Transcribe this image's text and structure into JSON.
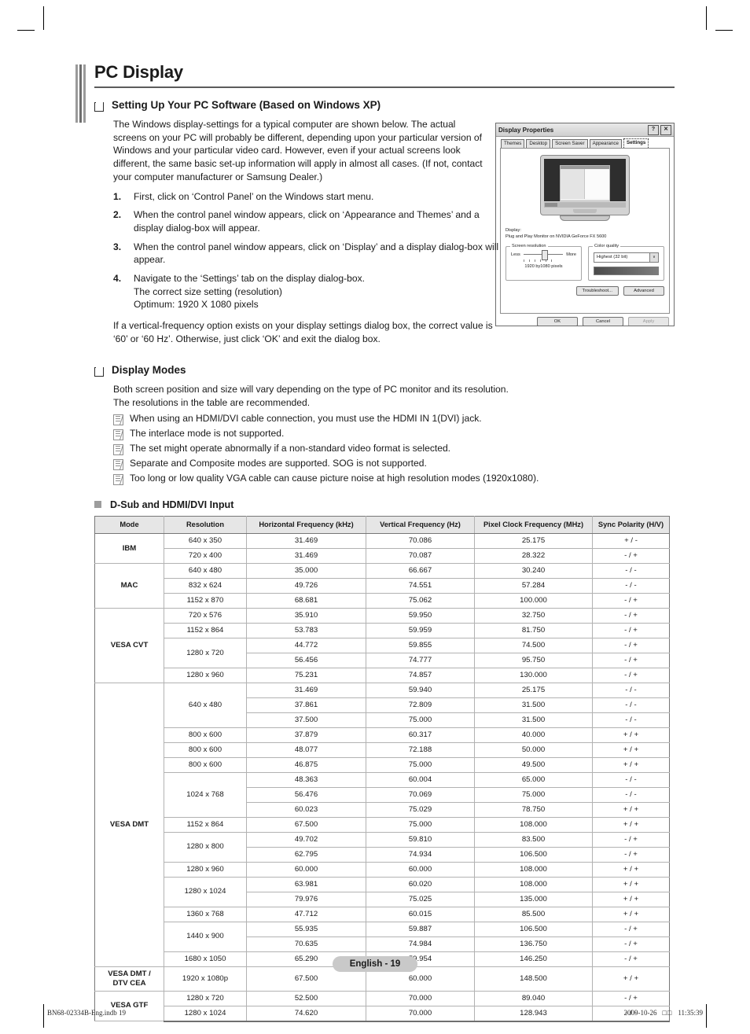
{
  "page": {
    "title": "PC Display",
    "page_label": "English - 19",
    "print_file": "BN68-02334B-Eng.indb   19",
    "print_date": "2009-10-26",
    "print_locale_glyphs": "□□",
    "print_time": "11:35:39"
  },
  "section1": {
    "heading": "Setting Up Your PC Software (Based on Windows XP)",
    "intro": "The Windows display-settings for a typical computer are shown below. The actual screens on your PC will probably be different, depending upon your particular version of Windows and your particular video card. However, even if your actual screens look different, the same basic set-up information will apply in almost all cases. (If not, contact your computer manufacturer or Samsung Dealer.)",
    "steps": [
      {
        "num": "1.",
        "text": "First, click on ‘Control Panel’ on the Windows start menu."
      },
      {
        "num": "2.",
        "text": "When the control panel window appears, click on ‘Appearance and Themes’ and a display dialog-box will appear."
      },
      {
        "num": "3.",
        "text": "When the control panel window appears, click on ‘Display’ and a display dialog-box will appear."
      },
      {
        "num": "4.",
        "text": "Navigate to the ‘Settings’ tab on the display dialog-box.\nThe correct size setting (resolution)\nOptimum: 1920 X 1080 pixels"
      }
    ],
    "closing": "If a vertical-frequency option exists on your display settings dialog box, the correct value is ‘60’ or ‘60 Hz’. Otherwise, just click ‘OK’ and exit the dialog box."
  },
  "display_properties": {
    "window_title": "Display Properties",
    "help_button": "?",
    "close_button": "✕",
    "tabs": [
      "Themes",
      "Desktop",
      "Screen Saver",
      "Appearance",
      "Settings"
    ],
    "active_tab": "Settings",
    "display_label": "Display:",
    "display_value": "Plug and Play Monitor on NVIDIA GeForce FX 5600",
    "screen_resolution": {
      "legend": "Screen resolution",
      "less_label": "Less",
      "more_label": "More",
      "value": "1920 by1080 pixels"
    },
    "color_quality": {
      "legend": "Color quality",
      "value": "Highest (32 bit)",
      "arrow": "∨"
    },
    "troubleshoot_button": "Troubleshoot...",
    "advanced_button": "Advanced",
    "ok_button": "OK",
    "cancel_button": "Cancel",
    "apply_button": "Apply"
  },
  "section2": {
    "heading": "Display Modes",
    "intro_line1": "Both screen position and size will vary depending on the type of PC monitor and its resolution.",
    "intro_line2": "The resolutions in the table are recommended.",
    "notes": [
      "When using an HDMI/DVI cable connection, you must use the HDMI IN 1(DVI) jack.",
      "The interlace mode is not supported.",
      "The set might operate abnormally if a non-standard video format is selected.",
      "Separate and Composite modes are supported. SOG is not supported.",
      "Too long or low quality VGA cable can cause picture noise at high resolution modes (1920x1080)."
    ],
    "subheading": "D-Sub and HDMI/DVI Input"
  },
  "table": {
    "columns": [
      "Mode",
      "Resolution",
      "Horizontal Frequency (kHz)",
      "Vertical Frequency (Hz)",
      "Pixel Clock Frequency (MHz)",
      "Sync Polarity (H/V)"
    ],
    "groups": [
      {
        "mode": "IBM",
        "rows": [
          {
            "resolution": "640 x 350",
            "res_span": 1,
            "h": "31.469",
            "v": "70.086",
            "pclk": "25.175",
            "sync": "+ / -"
          },
          {
            "resolution": "720 x 400",
            "res_span": 1,
            "h": "31.469",
            "v": "70.087",
            "pclk": "28.322",
            "sync": "- / +"
          }
        ]
      },
      {
        "mode": "MAC",
        "rows": [
          {
            "resolution": "640 x 480",
            "res_span": 1,
            "h": "35.000",
            "v": "66.667",
            "pclk": "30.240",
            "sync": "- / -"
          },
          {
            "resolution": "832 x 624",
            "res_span": 1,
            "h": "49.726",
            "v": "74.551",
            "pclk": "57.284",
            "sync": "- / -"
          },
          {
            "resolution": "1152 x 870",
            "res_span": 1,
            "h": "68.681",
            "v": "75.062",
            "pclk": "100.000",
            "sync": "- / +"
          }
        ]
      },
      {
        "mode": "VESA CVT",
        "rows": [
          {
            "resolution": "720 x 576",
            "res_span": 1,
            "h": "35.910",
            "v": "59.950",
            "pclk": "32.750",
            "sync": "- / +"
          },
          {
            "resolution": "1152 x 864",
            "res_span": 1,
            "h": "53.783",
            "v": "59.959",
            "pclk": "81.750",
            "sync": "- / +"
          },
          {
            "resolution": "1280 x 720",
            "res_span": 2,
            "h": "44.772",
            "v": "59.855",
            "pclk": "74.500",
            "sync": "- / +"
          },
          {
            "resolution": null,
            "res_span": 0,
            "h": "56.456",
            "v": "74.777",
            "pclk": "95.750",
            "sync": "- / +"
          },
          {
            "resolution": "1280 x 960",
            "res_span": 1,
            "h": "75.231",
            "v": "74.857",
            "pclk": "130.000",
            "sync": "- / +"
          }
        ]
      },
      {
        "mode": "VESA DMT",
        "rows": [
          {
            "resolution": "640 x 480",
            "res_span": 3,
            "h": "31.469",
            "v": "59.940",
            "pclk": "25.175",
            "sync": "- / -"
          },
          {
            "resolution": null,
            "res_span": 0,
            "h": "37.861",
            "v": "72.809",
            "pclk": "31.500",
            "sync": "- / -"
          },
          {
            "resolution": null,
            "res_span": 0,
            "h": "37.500",
            "v": "75.000",
            "pclk": "31.500",
            "sync": "- / -"
          },
          {
            "resolution": "800 x 600",
            "res_span": 1,
            "h": "37.879",
            "v": "60.317",
            "pclk": "40.000",
            "sync": "+ / +"
          },
          {
            "resolution": "800 x 600",
            "res_span": 1,
            "h": "48.077",
            "v": "72.188",
            "pclk": "50.000",
            "sync": "+ / +"
          },
          {
            "resolution": "800 x 600",
            "res_span": 1,
            "h": "46.875",
            "v": "75.000",
            "pclk": "49.500",
            "sync": "+ / +"
          },
          {
            "resolution": "1024 x 768",
            "res_span": 3,
            "h": "48.363",
            "v": "60.004",
            "pclk": "65.000",
            "sync": "- / -"
          },
          {
            "resolution": null,
            "res_span": 0,
            "h": "56.476",
            "v": "70.069",
            "pclk": "75.000",
            "sync": "- / -"
          },
          {
            "resolution": null,
            "res_span": 0,
            "h": "60.023",
            "v": "75.029",
            "pclk": "78.750",
            "sync": "+ / +"
          },
          {
            "resolution": "1152 x 864",
            "res_span": 1,
            "h": "67.500",
            "v": "75.000",
            "pclk": "108.000",
            "sync": "+ / +"
          },
          {
            "resolution": "1280 x 800",
            "res_span": 2,
            "h": "49.702",
            "v": "59.810",
            "pclk": "83.500",
            "sync": "- / +"
          },
          {
            "resolution": null,
            "res_span": 0,
            "h": "62.795",
            "v": "74.934",
            "pclk": "106.500",
            "sync": "- / +"
          },
          {
            "resolution": "1280 x 960",
            "res_span": 1,
            "h": "60.000",
            "v": "60.000",
            "pclk": "108.000",
            "sync": "+ / +"
          },
          {
            "resolution": "1280 x 1024",
            "res_span": 2,
            "h": "63.981",
            "v": "60.020",
            "pclk": "108.000",
            "sync": "+ / +"
          },
          {
            "resolution": null,
            "res_span": 0,
            "h": "79.976",
            "v": "75.025",
            "pclk": "135.000",
            "sync": "+ / +"
          },
          {
            "resolution": "1360 x 768",
            "res_span": 1,
            "h": "47.712",
            "v": "60.015",
            "pclk": "85.500",
            "sync": "+ / +"
          },
          {
            "resolution": "1440 x 900",
            "res_span": 2,
            "h": "55.935",
            "v": "59.887",
            "pclk": "106.500",
            "sync": "- / +"
          },
          {
            "resolution": null,
            "res_span": 0,
            "h": "70.635",
            "v": "74.984",
            "pclk": "136.750",
            "sync": "- / +"
          },
          {
            "resolution": "1680 x 1050",
            "res_span": 1,
            "h": "65.290",
            "v": "59.954",
            "pclk": "146.250",
            "sync": "- / +"
          }
        ]
      },
      {
        "mode": "VESA DMT /\nDTV CEA",
        "rows": [
          {
            "resolution": "1920 x 1080p",
            "res_span": 1,
            "h": "67.500",
            "v": "60.000",
            "pclk": "148.500",
            "sync": "+ / +"
          }
        ]
      },
      {
        "mode": "VESA GTF",
        "rows": [
          {
            "resolution": "1280 x 720",
            "res_span": 1,
            "h": "52.500",
            "v": "70.000",
            "pclk": "89.040",
            "sync": "- / +"
          },
          {
            "resolution": "1280 x 1024",
            "res_span": 1,
            "h": "74.620",
            "v": "70.000",
            "pclk": "128.943",
            "sync": "- / -"
          }
        ]
      }
    ]
  }
}
